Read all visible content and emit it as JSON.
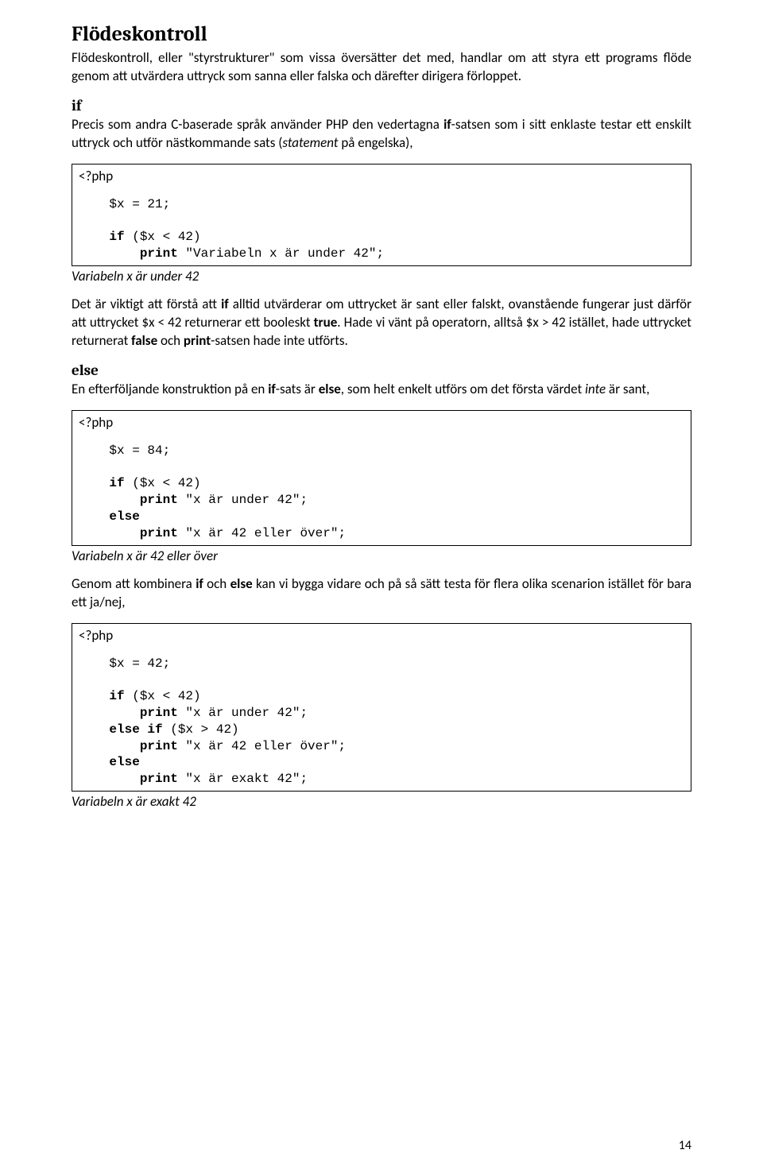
{
  "title": "Flödeskontroll",
  "intro": "Flödeskontroll, eller \"styrstrukturer\" som vissa översätter det med, handlar om att styra ett programs flöde genom att utvärdera uttryck som sanna eller falska och därefter dirigera förloppet.",
  "if_head": "if",
  "if_text1": "Precis som andra C-baserade språk använder PHP den vedertagna ",
  "if_text2": "-satsen som i sitt enklaste testar ett enskilt uttryck och utför nästkommande sats (",
  "if_statement_word": "statement",
  "if_text3": " på engelska),",
  "if_bold_word": "if",
  "php_open": "<?php",
  "code1": {
    "line1": "    $x = 21;",
    "line2": "    ",
    "line3a": "    ",
    "line3b_kw": "if",
    "line3c": " ($x < 42)",
    "line4a": "        ",
    "line4b_kw": "print",
    "line4c": " \"Variabeln x är under 42\";"
  },
  "result1": "Variabeln x är under 42",
  "para2a": "Det är viktigt att förstå att ",
  "para2_if": "if",
  "para2b": " alltid utvärderar om uttrycket är sant eller falskt, ovanstående fungerar just därför att uttrycket $x < 42 returnerar ett booleskt ",
  "para2_true": "true",
  "para2c": ". Hade vi vänt på operatorn, alltså $x > 42 istället, hade uttrycket returnerat ",
  "para2_false": "false",
  "para2d": " och ",
  "para2_print": "print",
  "para2e": "-satsen hade inte utförts.",
  "else_head": "else",
  "else_text1": "En efterföljande konstruktion på en ",
  "else_if": "if",
  "else_text2": "-sats är ",
  "else_else": "else",
  "else_text3": ", som helt enkelt utförs om det första värdet ",
  "else_inte": "inte",
  "else_text4": " är sant,",
  "code2": {
    "line1": "    $x = 84;",
    "line2": "    ",
    "line3a": "    ",
    "line3b_kw": "if",
    "line3c": " ($x < 42)",
    "line4a": "        ",
    "line4b_kw": "print",
    "line4c": " \"x är under 42\";",
    "line5a": "    ",
    "line5b_kw": "else",
    "line6a": "        ",
    "line6b_kw": "print",
    "line6c": " \"x är 42 eller över\";"
  },
  "result2": "Variabeln x är 42 eller över",
  "para3a": "Genom att kombinera ",
  "para3_if": "if",
  "para3b": " och ",
  "para3_else": "else",
  "para3c": " kan vi bygga vidare och på så sätt testa för flera olika scenarion istället för bara ett ja/nej,",
  "code3": {
    "line1": "    $x = 42;",
    "line2": "    ",
    "line3a": "    ",
    "line3b_kw": "if",
    "line3c": " ($x < 42)",
    "line4a": "        ",
    "line4b_kw": "print",
    "line4c": " \"x är under 42\";",
    "line5a": "    ",
    "line5b_kw": "else if",
    "line5c": " ($x > 42)",
    "line6a": "        ",
    "line6b_kw": "print",
    "line6c": " \"x är 42 eller över\";",
    "line7a": "    ",
    "line7b_kw": "else",
    "line8a": "        ",
    "line8b_kw": "print",
    "line8c": " \"x är exakt 42\";"
  },
  "result3": "Variabeln x är exakt 42",
  "page_number": "14"
}
